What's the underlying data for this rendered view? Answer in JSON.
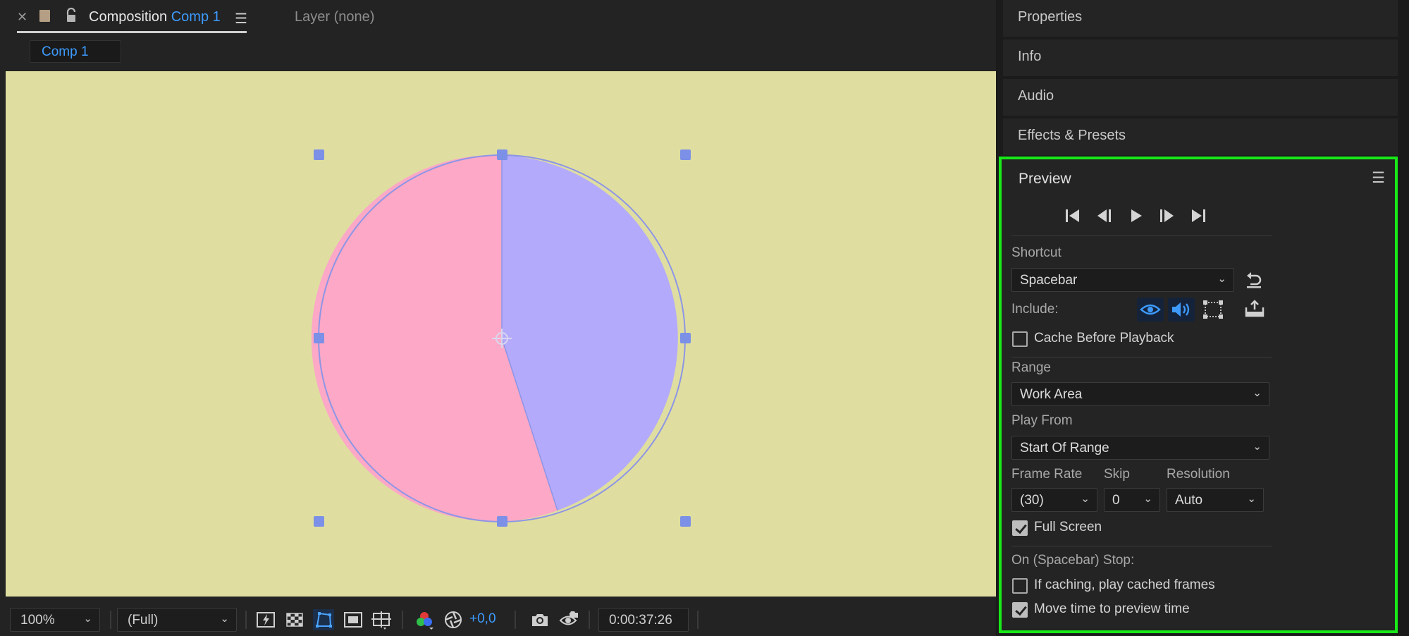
{
  "composition_tab": {
    "prefix": "Composition",
    "comp_name": "Comp 1",
    "layer_tab": "Layer (none)",
    "sub_tab": "Comp 1"
  },
  "viewer": {
    "background_color": "#dfdea0",
    "pie_colors": {
      "pink": "#fca8c6",
      "lavender": "#b3aafb",
      "outline": "#8d95e6",
      "handle": "#7b90e6"
    }
  },
  "bottom_bar": {
    "zoom": "100%",
    "resolution": "(Full)",
    "exposure": "+0,0",
    "timecode": "0:00:37:26",
    "icons": [
      "fast-preview-icon",
      "transparency-grid-icon",
      "mask-path-icon",
      "region-of-interest-icon",
      "guides-icon",
      "color-channels-icon",
      "exposure-reset-icon",
      "snapshot-icon",
      "show-snapshot-icon"
    ]
  },
  "panels": {
    "properties": "Properties",
    "info": "Info",
    "audio": "Audio",
    "effects": "Effects & Presets"
  },
  "preview": {
    "title": "Preview",
    "controls": [
      "first-frame-icon",
      "previous-frame-icon",
      "play-icon",
      "next-frame-icon",
      "last-frame-icon"
    ],
    "shortcut_label": "Shortcut",
    "shortcut_value": "Spacebar",
    "include_label": "Include:",
    "cache_before_playback": {
      "label": "Cache Before Playback",
      "checked": false
    },
    "range_label": "Range",
    "range_value": "Work Area",
    "play_from_label": "Play From",
    "play_from_value": "Start Of Range",
    "frame_rate_label": "Frame Rate",
    "frame_rate_value": "(30)",
    "skip_label": "Skip",
    "skip_value": "0",
    "resolution_label": "Resolution",
    "resolution_value": "Auto",
    "full_screen": {
      "label": "Full Screen",
      "checked": true
    },
    "on_stop_label": "On (Spacebar) Stop:",
    "if_caching": {
      "label": "If caching, play cached frames",
      "checked": false
    },
    "move_time": {
      "label": "Move time to preview time",
      "checked": true
    }
  },
  "colors": {
    "accent": "#3d9bff",
    "highlight_border": "#18e918"
  }
}
